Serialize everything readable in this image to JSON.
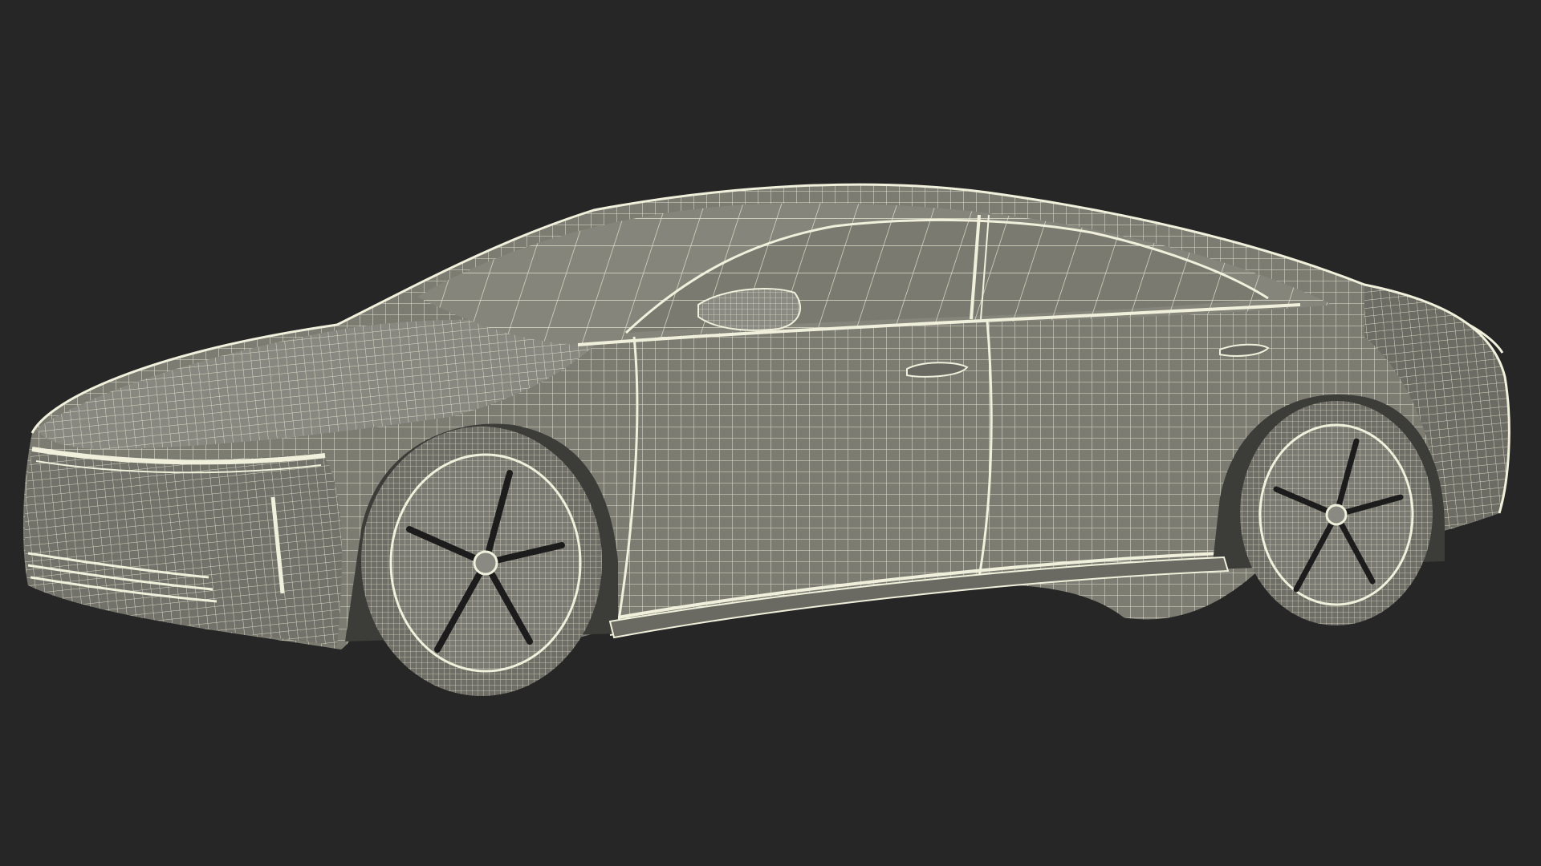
{
  "colors": {
    "background": "#262626",
    "body_fill": "#7c7c73",
    "body_shadow": "#5e5e57",
    "glass_fill": "#85857b",
    "tire_fill": "#6e6e66",
    "wire": "#f0f0dc",
    "slot_dark": "#1c1c1c"
  },
  "subject": {
    "icon": "car-icon"
  }
}
